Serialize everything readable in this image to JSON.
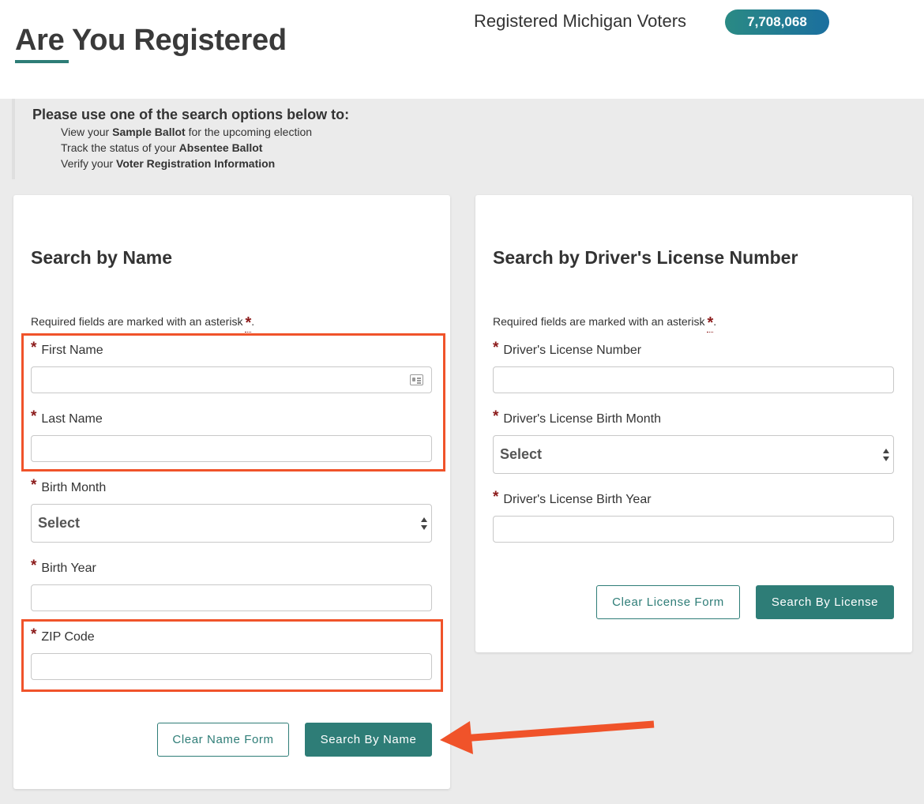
{
  "header": {
    "title": "Are You Registered",
    "voters_label": "Registered Michigan Voters",
    "voters_count": "7,708,068"
  },
  "intro": {
    "heading": "Please use one of the search options below to:",
    "items": [
      {
        "prefix": "View your ",
        "bold": "Sample Ballot",
        "suffix": " for the upcoming election"
      },
      {
        "prefix": "Track the status of your ",
        "bold": "Absentee Ballot",
        "suffix": ""
      },
      {
        "prefix": "Verify your ",
        "bold": "Voter Registration Information",
        "suffix": ""
      }
    ]
  },
  "name_form": {
    "title": "Search by Name",
    "required_note": "Required fields are marked with an asterisk",
    "required_star": "*",
    "first_name_label": "First Name",
    "first_name_value": "",
    "last_name_label": "Last Name",
    "last_name_value": "",
    "birth_month_label": "Birth Month",
    "birth_month_value": "Select",
    "birth_year_label": "Birth Year",
    "birth_year_value": "",
    "zip_label": "ZIP Code",
    "zip_value": "",
    "clear_button": "Clear Name Form",
    "search_button": "Search By Name"
  },
  "license_form": {
    "title": "Search by Driver's License Number",
    "required_note": "Required fields are marked with an asterisk",
    "required_star": "*",
    "license_number_label": "Driver's License Number",
    "license_number_value": "",
    "birth_month_label": "Driver's License Birth Month",
    "birth_month_value": "Select",
    "birth_year_label": "Driver's License Birth Year",
    "birth_year_value": "",
    "clear_button": "Clear License Form",
    "search_button": "Search By License"
  },
  "colors": {
    "accent": "#2e7d77",
    "highlight": "#f0532a",
    "required": "#8b1a1a",
    "badge_gradient_end": "#1b6f9f"
  },
  "icons": {
    "autofill": "contact-card-icon",
    "select": "updown-arrows-icon",
    "annotation": "arrow-left-icon"
  }
}
